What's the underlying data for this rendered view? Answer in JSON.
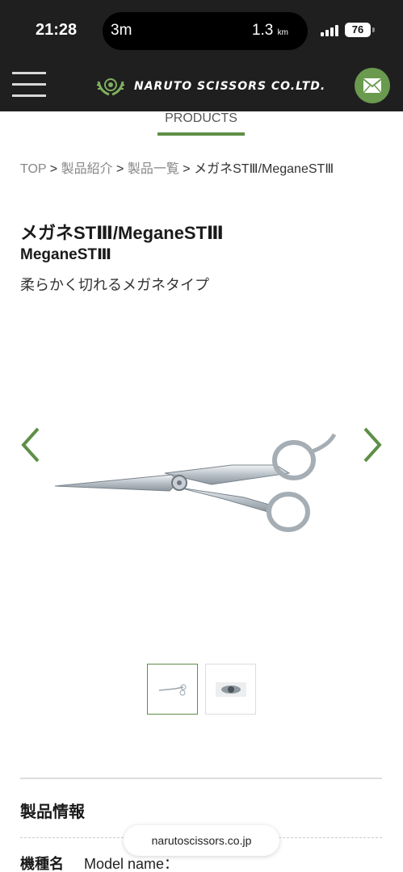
{
  "status_bar": {
    "time": "21:28",
    "live_activity_left": "3m",
    "live_activity_right": "1.3",
    "live_activity_unit": "km",
    "battery": "76"
  },
  "header": {
    "logo_text": "NARUTO SCISSORS CO.LTD.",
    "menu_icon": "hamburger-icon",
    "mail_icon": "mail-icon",
    "accent_color": "#6a9a4e"
  },
  "tab": {
    "label": "PRODUCTS"
  },
  "breadcrumb": {
    "items": [
      "TOP",
      "製品紹介",
      "製品一覧"
    ],
    "separator": ">",
    "current": "メガネSTⅢ/MeganeSTⅢ"
  },
  "product": {
    "title": "メガネSTⅢ/MeganeSTⅢ",
    "subtitle": "MeganeSTⅢ",
    "description": "柔らかく切れるメガネタイプ"
  },
  "gallery": {
    "prev_icon": "chevron-left-icon",
    "next_icon": "chevron-right-icon",
    "thumbnail_count": 2,
    "selected_index": 0
  },
  "info": {
    "heading": "製品情報",
    "model_label": "機種名",
    "model_value": "Model name："
  },
  "browser": {
    "url": "narutoscissors.co.jp"
  }
}
